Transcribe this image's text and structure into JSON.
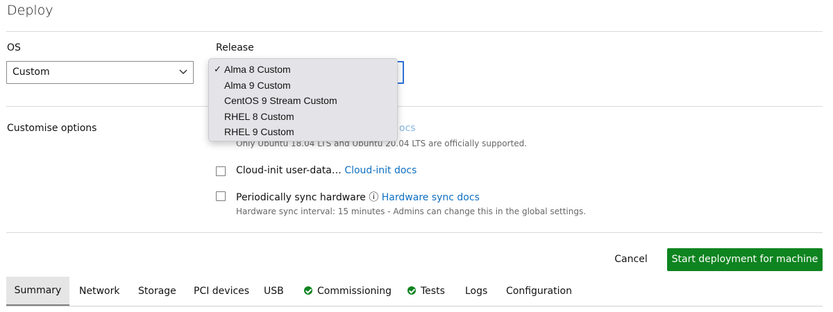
{
  "page": {
    "title": "Deploy"
  },
  "os": {
    "label": "OS",
    "value": "Custom"
  },
  "release": {
    "label": "Release",
    "options": [
      "Alma 8 Custom",
      "Alma 9 Custom",
      "CentOS 9 Stream Custom",
      "RHEL 8 Custom",
      "RHEL 9 Custom"
    ],
    "selected_index": 0,
    "check_glyph": "✓"
  },
  "customise": {
    "label": "Customise options",
    "hidden_link_fragment": "ocs",
    "ubuntu_help": "Only Ubuntu 18.04 LTS and Ubuntu 20.04 LTS are officially supported.",
    "cloud_init": {
      "label": "Cloud-init user-data…",
      "link": "Cloud-init docs",
      "checked": false
    },
    "sync": {
      "label": "Periodically sync hardware",
      "info_glyph": "ⓘ",
      "link": "Hardware sync docs",
      "help": "Hardware sync interval: 15 minutes - Admins can change this in the global settings.",
      "checked": false
    }
  },
  "actions": {
    "cancel": "Cancel",
    "submit": "Start deployment for machine"
  },
  "tabs": [
    {
      "label": "Summary",
      "active": true,
      "status": ""
    },
    {
      "label": "Network",
      "active": false,
      "status": ""
    },
    {
      "label": "Storage",
      "active": false,
      "status": ""
    },
    {
      "label": "PCI devices",
      "active": false,
      "status": ""
    },
    {
      "label": "USB",
      "active": false,
      "status": ""
    },
    {
      "label": "Commissioning",
      "active": false,
      "status": "success"
    },
    {
      "label": "Tests",
      "active": false,
      "status": "success"
    },
    {
      "label": "Logs",
      "active": false,
      "status": ""
    },
    {
      "label": "Configuration",
      "active": false,
      "status": ""
    }
  ],
  "colors": {
    "primary_button": "#0e8420",
    "link": "#0e6fc2",
    "focus_border": "#2c6fd6",
    "success": "#0e8420"
  }
}
